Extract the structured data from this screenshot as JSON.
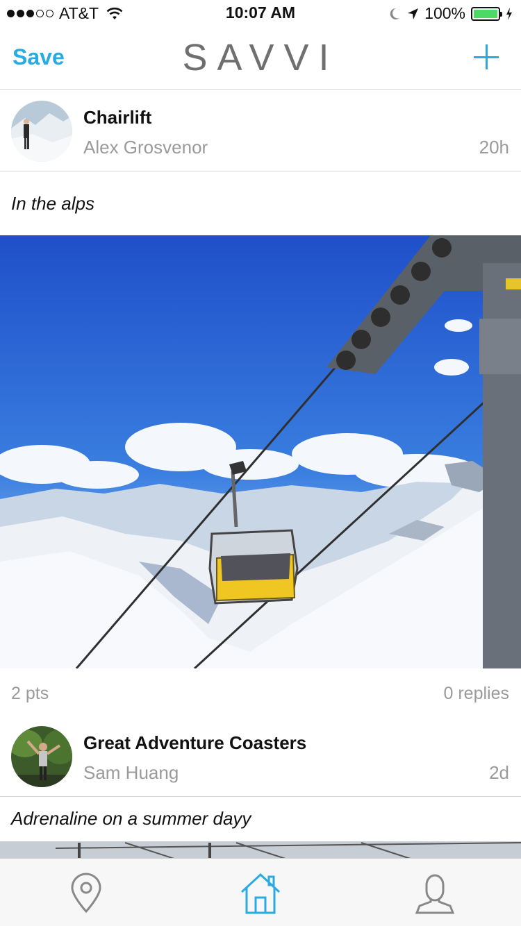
{
  "status_bar": {
    "carrier": "AT&T",
    "time": "10:07 AM",
    "battery": "100%",
    "signal_bars_filled": 3,
    "signal_bars_total": 5
  },
  "nav": {
    "save_label": "Save",
    "logo_text": "SAVVI",
    "add_icon": "plus-icon",
    "accent_color": "#29abe2"
  },
  "posts": [
    {
      "title": "Chairlift",
      "author": "Alex Grosvenor",
      "time": "20h",
      "caption": "In the alps",
      "points": "2 pts",
      "replies": "0 replies"
    },
    {
      "title": "Great Adventure Coasters",
      "author": "Sam Huang",
      "time": "2d",
      "caption": "Adrenaline on a summer dayy"
    }
  ],
  "tab_bar": {
    "tabs": [
      {
        "icon": "location-pin-icon",
        "active": false
      },
      {
        "icon": "home-icon",
        "active": true
      },
      {
        "icon": "profile-icon",
        "active": false
      }
    ]
  }
}
